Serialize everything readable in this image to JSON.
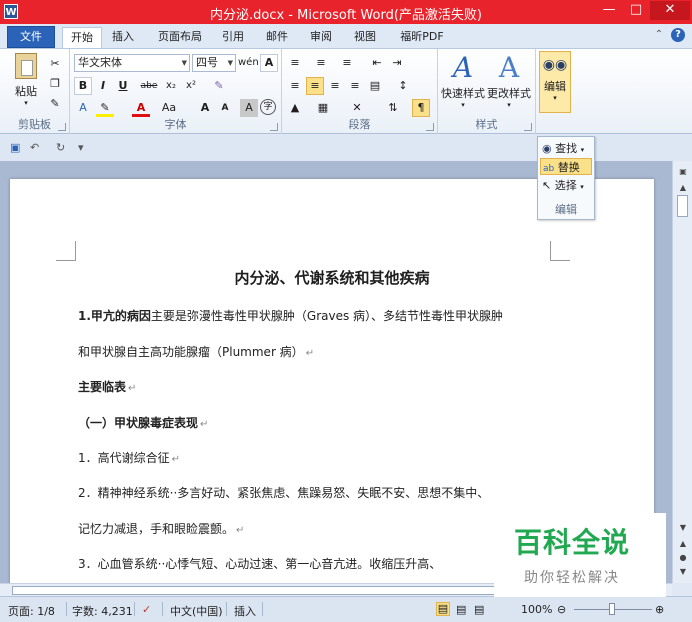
{
  "window": {
    "title": "内分泌.docx - Microsoft Word(产品激活失败)",
    "app_icon": "W",
    "minimize_icon": "minimize-icon",
    "maximize_icon": "maximize-icon",
    "close_icon": "close-icon"
  },
  "tabs": [
    "文件",
    "开始",
    "插入",
    "页面布局",
    "引用",
    "邮件",
    "审阅",
    "视图",
    "福昕PDF"
  ],
  "active_tab": "开始",
  "ribbon": {
    "clipboard": {
      "label": "剪贴板",
      "paste": "粘贴"
    },
    "font": {
      "label": "字体",
      "font_name": "华文宋体",
      "font_size": "四号",
      "bold": "B",
      "italic": "I",
      "underline": "U",
      "strike": "abe",
      "subscript": "x₂",
      "superscript": "x²",
      "grow": "A",
      "shrink": "A",
      "char_border": "A",
      "phonetic": "wén",
      "clear": "A",
      "font_color": "A",
      "case": "Aa",
      "char_shade": "A",
      "enclosed": "字"
    },
    "paragraph": {
      "label": "段落"
    },
    "styles": {
      "label": "样式",
      "quick_styles": "快速样式",
      "change_styles": "更改样式"
    },
    "editing": {
      "label": "编辑",
      "button": "编辑"
    }
  },
  "qat": [
    "save-icon",
    "undo-icon",
    "redo-icon",
    "customize-icon"
  ],
  "edit_popup": {
    "items": [
      "查找",
      "替换",
      "选择"
    ],
    "highlighted": "替换",
    "label": "编辑"
  },
  "document": {
    "title": "内分泌、代谢系统和其他疾病",
    "lines": [
      {
        "bold_prefix": "1.甲亢的病因",
        "text": "主要是弥漫性毒性甲状腺肿（Graves 病）、多结节性毒性甲状腺肿",
        "pm": ""
      },
      {
        "bold_prefix": "",
        "text": "和甲状腺自主高功能腺瘤（Plummer 病）",
        "pm": "↵"
      },
      {
        "bold_prefix": "主要临表",
        "text": "",
        "pm": "↵"
      },
      {
        "bold_prefix": "（一）甲状腺毒症表现",
        "text": "",
        "pm": "↵"
      },
      {
        "bold_prefix": "",
        "text": "1．高代谢综合征",
        "pm": "↵"
      },
      {
        "bold_prefix": "",
        "text": "2．精神神经系统··多言好动、紧张焦虑、焦躁易怒、失眠不安、思想不集中、",
        "pm": ""
      },
      {
        "bold_prefix": "",
        "text": "记忆力减退，手和眼睑震颤。",
        "pm": "↵"
      },
      {
        "bold_prefix": "",
        "text": "3．心血管系统··心悸气短、心动过速、第一心音亢进。收缩压升高、",
        "pm": ""
      }
    ]
  },
  "status": {
    "page": "页面: 1/8",
    "words": "字数: 4,231",
    "language": "中文(中国)",
    "mode": "插入",
    "zoom": "100%"
  },
  "watermark": {
    "title": "百科全说",
    "subtitle": "助你轻松解决"
  },
  "colors": {
    "titlebar": "#e8232b",
    "file_tab": "#2a63b8",
    "highlight": "#fbe08a",
    "watermark_green": "#21a851"
  }
}
